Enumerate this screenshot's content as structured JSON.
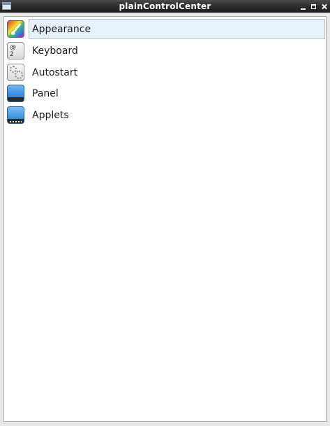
{
  "window": {
    "title": "plainControlCenter",
    "controls": [
      "minimize-icon",
      "maximize-icon",
      "close-icon"
    ]
  },
  "items": [
    {
      "label": "Appearance",
      "icon": "appearance-icon",
      "selected": true
    },
    {
      "label": "Keyboard",
      "icon": "keyboard-icon",
      "selected": false
    },
    {
      "label": "Autostart",
      "icon": "autostart-icon",
      "selected": false
    },
    {
      "label": "Panel",
      "icon": "panel-icon",
      "selected": false
    },
    {
      "label": "Applets",
      "icon": "applets-icon",
      "selected": false
    }
  ],
  "keyboard_icon_glyphs": [
    "@",
    "2"
  ],
  "colors": {
    "selection_bg": "#e6f1fa",
    "selection_border": "#a6c6e2",
    "titlebar": "#2b2b2b"
  }
}
